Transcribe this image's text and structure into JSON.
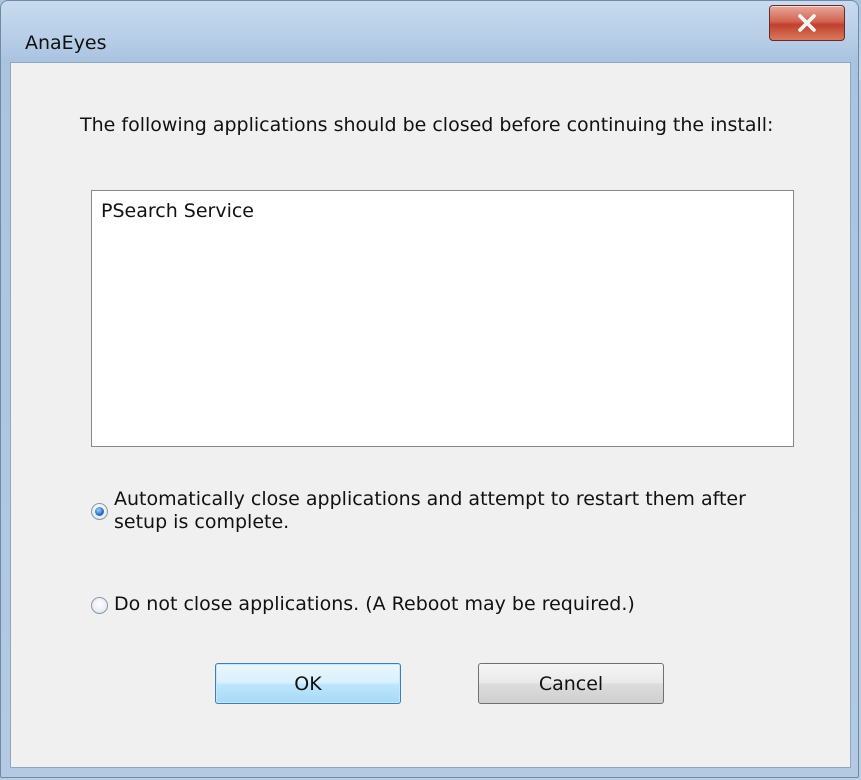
{
  "window": {
    "title": "AnaEyes"
  },
  "dialog": {
    "message": "The following applications should be closed before continuing the install:",
    "applications": [
      "PSearch Service"
    ],
    "options": [
      {
        "label": "Automatically close applications and attempt to restart them after setup is complete.",
        "selected": true
      },
      {
        "label": "Do not close applications. (A Reboot may be required.)",
        "selected": false
      }
    ]
  },
  "buttons": {
    "ok_label": "OK",
    "cancel_label": "Cancel"
  },
  "icons": {
    "close": "close-icon"
  },
  "colors": {
    "close_button": "#c7432f",
    "default_button_border": "#3c7fb1",
    "client_background": "#f0f0f0"
  }
}
